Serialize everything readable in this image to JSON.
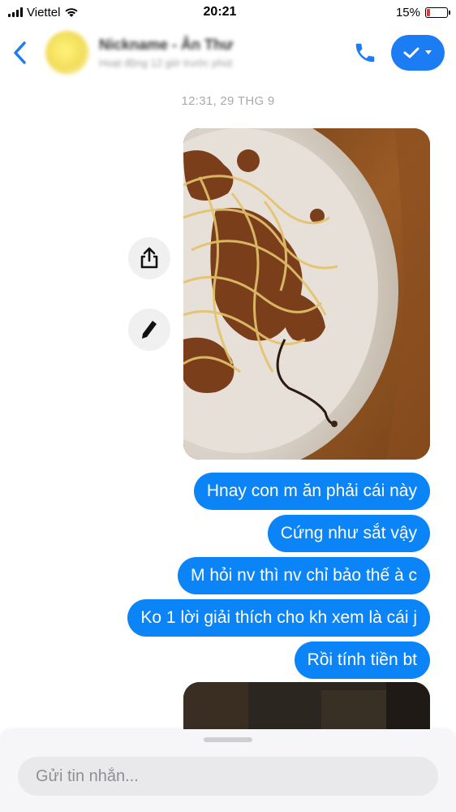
{
  "status_bar": {
    "carrier": "Viettel",
    "time": "20:21",
    "battery_text": "15%",
    "battery_level": 0.15,
    "battery_color": "#e53935"
  },
  "header": {
    "back_icon": "chevron-left-icon",
    "contact_name": "Nickname - Ân Thư",
    "contact_status": "Hoạt động 12 giờ trước phút",
    "call_icon": "phone-icon",
    "action_icon": "check-dropdown-icon",
    "accent_color": "#1c7cf4"
  },
  "conversation": {
    "timestamp": "12:31, 29 THG 9",
    "photo_actions": [
      {
        "icon": "share-icon"
      },
      {
        "icon": "pencil-icon"
      }
    ],
    "messages": [
      {
        "text": "Hnay con m ăn phải cái này"
      },
      {
        "text": "Cứng như sắt vậy"
      },
      {
        "text": "M hỏi nv thì nv chỉ bảo thế à c"
      },
      {
        "text": "Ko 1 lời giải thích cho kh xem là cái j"
      },
      {
        "text": "Rồi tính tiền bt"
      }
    ],
    "bubble_color": "#0a84f6"
  },
  "composer": {
    "placeholder": "Gửi tin nhắn..."
  }
}
